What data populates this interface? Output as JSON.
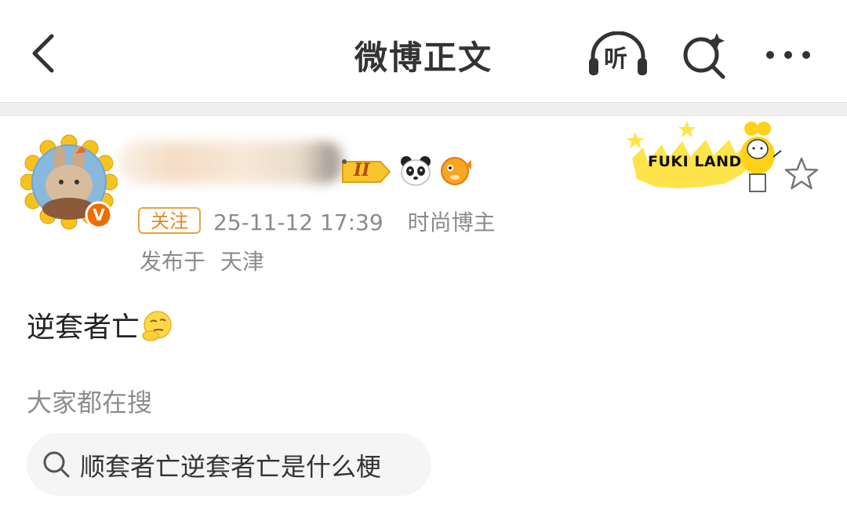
{
  "nav": {
    "title": "微博正文",
    "listen_label": "听",
    "icons": {
      "back": "back-chevron-icon",
      "listen": "headphones-icon",
      "search": "search-sparkle-icon",
      "more": "more-dots-icon"
    }
  },
  "author": {
    "avatar": "avatar",
    "verified_badge": "V",
    "level_badge": "II",
    "badge_icons": [
      "panda-icon",
      "pufferfish-icon"
    ],
    "follow_label": "关注",
    "timestamp": "25-11-12 17:39",
    "role": "时尚博主",
    "location_prefix": "发布于",
    "location": "天津",
    "fan_badge_text": "FUKI LAND"
  },
  "post": {
    "text": "逆套者亡",
    "emoji": "thinking-emoji"
  },
  "hot_search": {
    "label": "大家都在搜",
    "query": "顺套者亡逆套者亡是什么梗"
  },
  "colors": {
    "accent_orange": "#e08a1e",
    "verified_orange": "#f06c00",
    "muted_text": "#8b8b8b",
    "chip_bg": "#f5f5f5"
  }
}
